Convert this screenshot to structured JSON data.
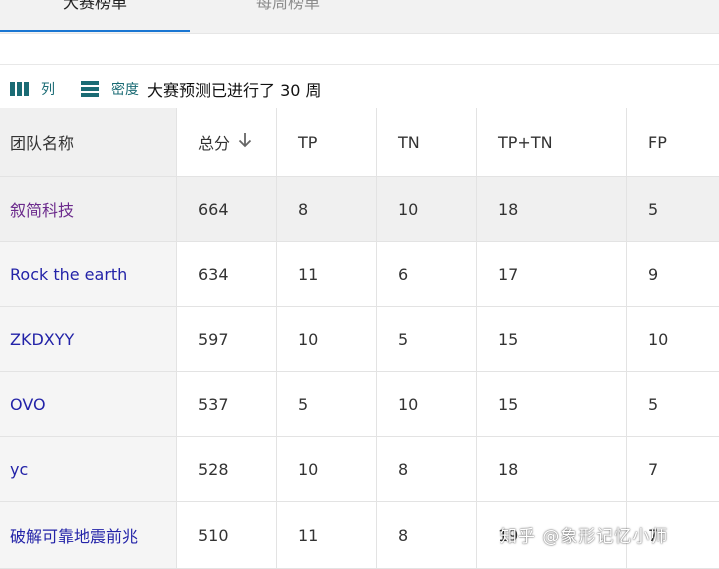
{
  "tabs": [
    {
      "label": "大赛榜单",
      "active": true
    },
    {
      "label": "每周榜单",
      "active": false
    }
  ],
  "toolbar": {
    "columns_label": "列",
    "density_label": "密度",
    "summary": "大赛预测已进行了 30 周"
  },
  "table": {
    "columns": [
      "团队名称",
      "总分",
      "TP",
      "TN",
      "TP+TN",
      "FP"
    ],
    "sort": {
      "column": "总分",
      "direction": "descending"
    },
    "rows": [
      {
        "team": "叙简科技",
        "total": "664",
        "tp": "8",
        "tn": "10",
        "tptn": "18",
        "fp": "5"
      },
      {
        "team": "Rock the earth",
        "total": "634",
        "tp": "11",
        "tn": "6",
        "tptn": "17",
        "fp": "9"
      },
      {
        "team": "ZKDXYY",
        "total": "597",
        "tp": "10",
        "tn": "5",
        "tptn": "15",
        "fp": "10"
      },
      {
        "team": "OVO",
        "total": "537",
        "tp": "5",
        "tn": "10",
        "tptn": "15",
        "fp": "5"
      },
      {
        "team": "yc",
        "total": "528",
        "tp": "10",
        "tn": "8",
        "tptn": "18",
        "fp": "7"
      },
      {
        "team": "破解可靠地震前兆",
        "total": "510",
        "tp": "11",
        "tn": "8",
        "tptn": "19",
        "fp": "7"
      }
    ]
  },
  "watermark": "知乎 @象形记忆小师",
  "colors": {
    "accent": "#1976d2",
    "toolbar_icon": "#1a6b74",
    "link": "#2323a8",
    "visited_link": "#6b2a8c"
  }
}
